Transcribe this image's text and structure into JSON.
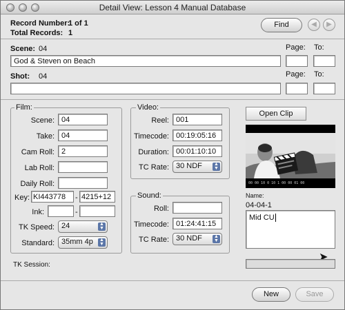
{
  "window": {
    "title": "Detail View: Lesson 4 Manual Database"
  },
  "records": {
    "record_number_label": "Record Number:",
    "record_number_value": "1 of 1",
    "total_records_label": "Total Records:",
    "total_records_value": "1"
  },
  "toolbar": {
    "find_label": "Find",
    "prev_icon": "arrow-left-icon",
    "next_icon": "arrow-right-icon"
  },
  "scene": {
    "label": "Scene:",
    "value": "04",
    "description": "God & Steven on Beach",
    "page_label": "Page:",
    "to_label": "To:"
  },
  "shot": {
    "label": "Shot:",
    "value": "04",
    "description": "",
    "page_label": "Page:",
    "to_label": "To:"
  },
  "film": {
    "group_label": "Film:",
    "scene_label": "Scene:",
    "scene_value": "04",
    "take_label": "Take:",
    "take_value": "04",
    "cam_roll_label": "Cam Roll:",
    "cam_roll_value": "2",
    "lab_roll_label": "Lab Roll:",
    "lab_roll_value": "",
    "daily_roll_label": "Daily Roll:",
    "daily_roll_value": "",
    "key_label": "Key:",
    "key_value_1": "KI443778",
    "key_sep": "-",
    "key_value_2": "4215+12",
    "ink_label": "Ink:",
    "ink_value_1": "",
    "ink_sep": "-",
    "ink_value_2": "",
    "tk_speed_label": "TK Speed:",
    "tk_speed_value": "24",
    "standard_label": "Standard:",
    "standard_value": "35mm 4p"
  },
  "video": {
    "group_label": "Video:",
    "reel_label": "Reel:",
    "reel_value": "001",
    "timecode_label": "Timecode:",
    "timecode_value": "00:19:05:16",
    "duration_label": "Duration:",
    "duration_value": "00:01:10:10",
    "tc_rate_label": "TC Rate:",
    "tc_rate_value": "30 NDF"
  },
  "sound": {
    "group_label": "Sound:",
    "roll_label": "Roll:",
    "roll_value": "",
    "timecode_label": "Timecode:",
    "timecode_value": "01:24:41:15",
    "tc_rate_label": "TC Rate:",
    "tc_rate_value": "30 NDF"
  },
  "clip": {
    "open_clip_label": "Open Clip",
    "name_label": "Name:",
    "name_value": "04-04-1",
    "notes_value": "Mid CU"
  },
  "tk_session": {
    "label": "TK Session:"
  },
  "footer": {
    "new_label": "New",
    "save_label": "Save"
  }
}
